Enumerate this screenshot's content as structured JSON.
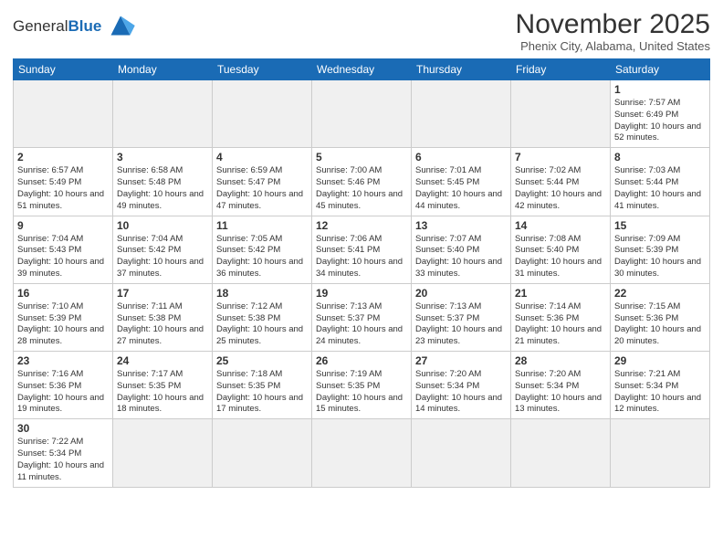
{
  "logo": {
    "text_general": "General",
    "text_blue": "Blue"
  },
  "header": {
    "month_title": "November 2025",
    "location": "Phenix City, Alabama, United States"
  },
  "days_of_week": [
    "Sunday",
    "Monday",
    "Tuesday",
    "Wednesday",
    "Thursday",
    "Friday",
    "Saturday"
  ],
  "weeks": [
    [
      {
        "day": "",
        "empty": true
      },
      {
        "day": "",
        "empty": true
      },
      {
        "day": "",
        "empty": true
      },
      {
        "day": "",
        "empty": true
      },
      {
        "day": "",
        "empty": true
      },
      {
        "day": "",
        "empty": true
      },
      {
        "day": "1",
        "info": "Sunrise: 7:57 AM\nSunset: 6:49 PM\nDaylight: 10 hours\nand 52 minutes."
      }
    ],
    [
      {
        "day": "2",
        "info": "Sunrise: 6:57 AM\nSunset: 5:49 PM\nDaylight: 10 hours\nand 51 minutes."
      },
      {
        "day": "3",
        "info": "Sunrise: 6:58 AM\nSunset: 5:48 PM\nDaylight: 10 hours\nand 49 minutes."
      },
      {
        "day": "4",
        "info": "Sunrise: 6:59 AM\nSunset: 5:47 PM\nDaylight: 10 hours\nand 47 minutes."
      },
      {
        "day": "5",
        "info": "Sunrise: 7:00 AM\nSunset: 5:46 PM\nDaylight: 10 hours\nand 45 minutes."
      },
      {
        "day": "6",
        "info": "Sunrise: 7:01 AM\nSunset: 5:45 PM\nDaylight: 10 hours\nand 44 minutes."
      },
      {
        "day": "7",
        "info": "Sunrise: 7:02 AM\nSunset: 5:44 PM\nDaylight: 10 hours\nand 42 minutes."
      },
      {
        "day": "8",
        "info": "Sunrise: 7:03 AM\nSunset: 5:44 PM\nDaylight: 10 hours\nand 41 minutes."
      }
    ],
    [
      {
        "day": "9",
        "info": "Sunrise: 7:04 AM\nSunset: 5:43 PM\nDaylight: 10 hours\nand 39 minutes."
      },
      {
        "day": "10",
        "info": "Sunrise: 7:04 AM\nSunset: 5:42 PM\nDaylight: 10 hours\nand 37 minutes."
      },
      {
        "day": "11",
        "info": "Sunrise: 7:05 AM\nSunset: 5:42 PM\nDaylight: 10 hours\nand 36 minutes."
      },
      {
        "day": "12",
        "info": "Sunrise: 7:06 AM\nSunset: 5:41 PM\nDaylight: 10 hours\nand 34 minutes."
      },
      {
        "day": "13",
        "info": "Sunrise: 7:07 AM\nSunset: 5:40 PM\nDaylight: 10 hours\nand 33 minutes."
      },
      {
        "day": "14",
        "info": "Sunrise: 7:08 AM\nSunset: 5:40 PM\nDaylight: 10 hours\nand 31 minutes."
      },
      {
        "day": "15",
        "info": "Sunrise: 7:09 AM\nSunset: 5:39 PM\nDaylight: 10 hours\nand 30 minutes."
      }
    ],
    [
      {
        "day": "16",
        "info": "Sunrise: 7:10 AM\nSunset: 5:39 PM\nDaylight: 10 hours\nand 28 minutes."
      },
      {
        "day": "17",
        "info": "Sunrise: 7:11 AM\nSunset: 5:38 PM\nDaylight: 10 hours\nand 27 minutes."
      },
      {
        "day": "18",
        "info": "Sunrise: 7:12 AM\nSunset: 5:38 PM\nDaylight: 10 hours\nand 25 minutes."
      },
      {
        "day": "19",
        "info": "Sunrise: 7:13 AM\nSunset: 5:37 PM\nDaylight: 10 hours\nand 24 minutes."
      },
      {
        "day": "20",
        "info": "Sunrise: 7:13 AM\nSunset: 5:37 PM\nDaylight: 10 hours\nand 23 minutes."
      },
      {
        "day": "21",
        "info": "Sunrise: 7:14 AM\nSunset: 5:36 PM\nDaylight: 10 hours\nand 21 minutes."
      },
      {
        "day": "22",
        "info": "Sunrise: 7:15 AM\nSunset: 5:36 PM\nDaylight: 10 hours\nand 20 minutes."
      }
    ],
    [
      {
        "day": "23",
        "info": "Sunrise: 7:16 AM\nSunset: 5:36 PM\nDaylight: 10 hours\nand 19 minutes."
      },
      {
        "day": "24",
        "info": "Sunrise: 7:17 AM\nSunset: 5:35 PM\nDaylight: 10 hours\nand 18 minutes."
      },
      {
        "day": "25",
        "info": "Sunrise: 7:18 AM\nSunset: 5:35 PM\nDaylight: 10 hours\nand 17 minutes."
      },
      {
        "day": "26",
        "info": "Sunrise: 7:19 AM\nSunset: 5:35 PM\nDaylight: 10 hours\nand 15 minutes."
      },
      {
        "day": "27",
        "info": "Sunrise: 7:20 AM\nSunset: 5:34 PM\nDaylight: 10 hours\nand 14 minutes."
      },
      {
        "day": "28",
        "info": "Sunrise: 7:20 AM\nSunset: 5:34 PM\nDaylight: 10 hours\nand 13 minutes."
      },
      {
        "day": "29",
        "info": "Sunrise: 7:21 AM\nSunset: 5:34 PM\nDaylight: 10 hours\nand 12 minutes."
      }
    ],
    [
      {
        "day": "30",
        "info": "Sunrise: 7:22 AM\nSunset: 5:34 PM\nDaylight: 10 hours\nand 11 minutes."
      },
      {
        "day": "",
        "empty": true
      },
      {
        "day": "",
        "empty": true
      },
      {
        "day": "",
        "empty": true
      },
      {
        "day": "",
        "empty": true
      },
      {
        "day": "",
        "empty": true
      },
      {
        "day": "",
        "empty": true
      }
    ]
  ]
}
